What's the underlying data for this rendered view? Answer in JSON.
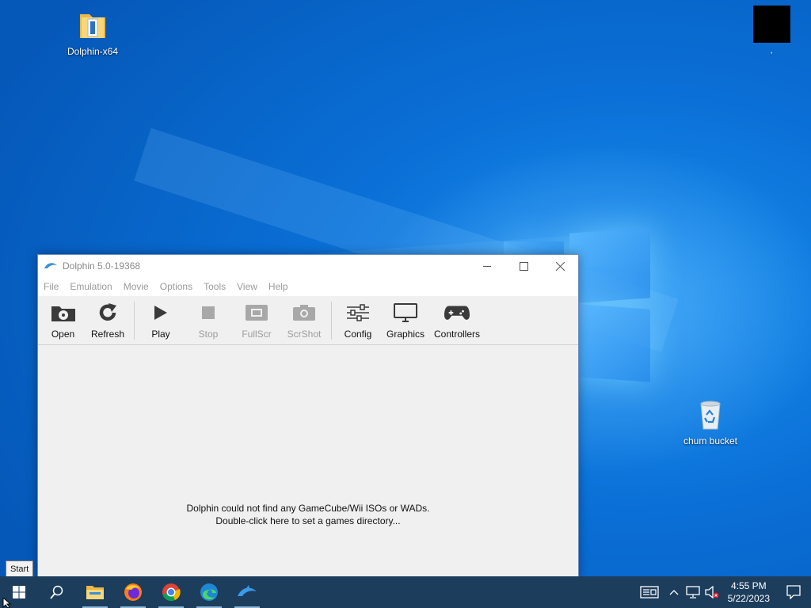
{
  "desktop": {
    "icons": [
      {
        "label": "Dolphin-x64"
      },
      {
        "label": ","
      },
      {
        "label": "chum bucket"
      }
    ]
  },
  "window": {
    "title": "Dolphin 5.0-19368",
    "menu": [
      "File",
      "Emulation",
      "Movie",
      "Options",
      "Tools",
      "View",
      "Help"
    ],
    "toolbar": [
      {
        "label": "Open",
        "enabled": true
      },
      {
        "label": "Refresh",
        "enabled": true
      },
      {
        "label": "Play",
        "enabled": true
      },
      {
        "label": "Stop",
        "enabled": false
      },
      {
        "label": "FullScr",
        "enabled": false
      },
      {
        "label": "ScrShot",
        "enabled": false
      },
      {
        "label": "Config",
        "enabled": true
      },
      {
        "label": "Graphics",
        "enabled": true
      },
      {
        "label": "Controllers",
        "enabled": true
      }
    ],
    "empty_message": {
      "line1": "Dolphin could not find any GameCube/Wii ISOs or WADs.",
      "line2": "Double-click here to set a games directory..."
    }
  },
  "tooltip": {
    "start": "Start"
  },
  "taskbar": {
    "pinned": [
      "windows-start-icon",
      "search-icon",
      "file-explorer-icon",
      "firefox-icon",
      "chrome-icon",
      "edge-icon",
      "dolphin-icon"
    ],
    "clock": {
      "time": "4:55 PM",
      "date": "5/22/2023"
    }
  },
  "colors": {
    "desktop_blue": "#0a6fd6",
    "taskbar": "#1c3d5c",
    "window_bg": "#f0f0f0"
  }
}
